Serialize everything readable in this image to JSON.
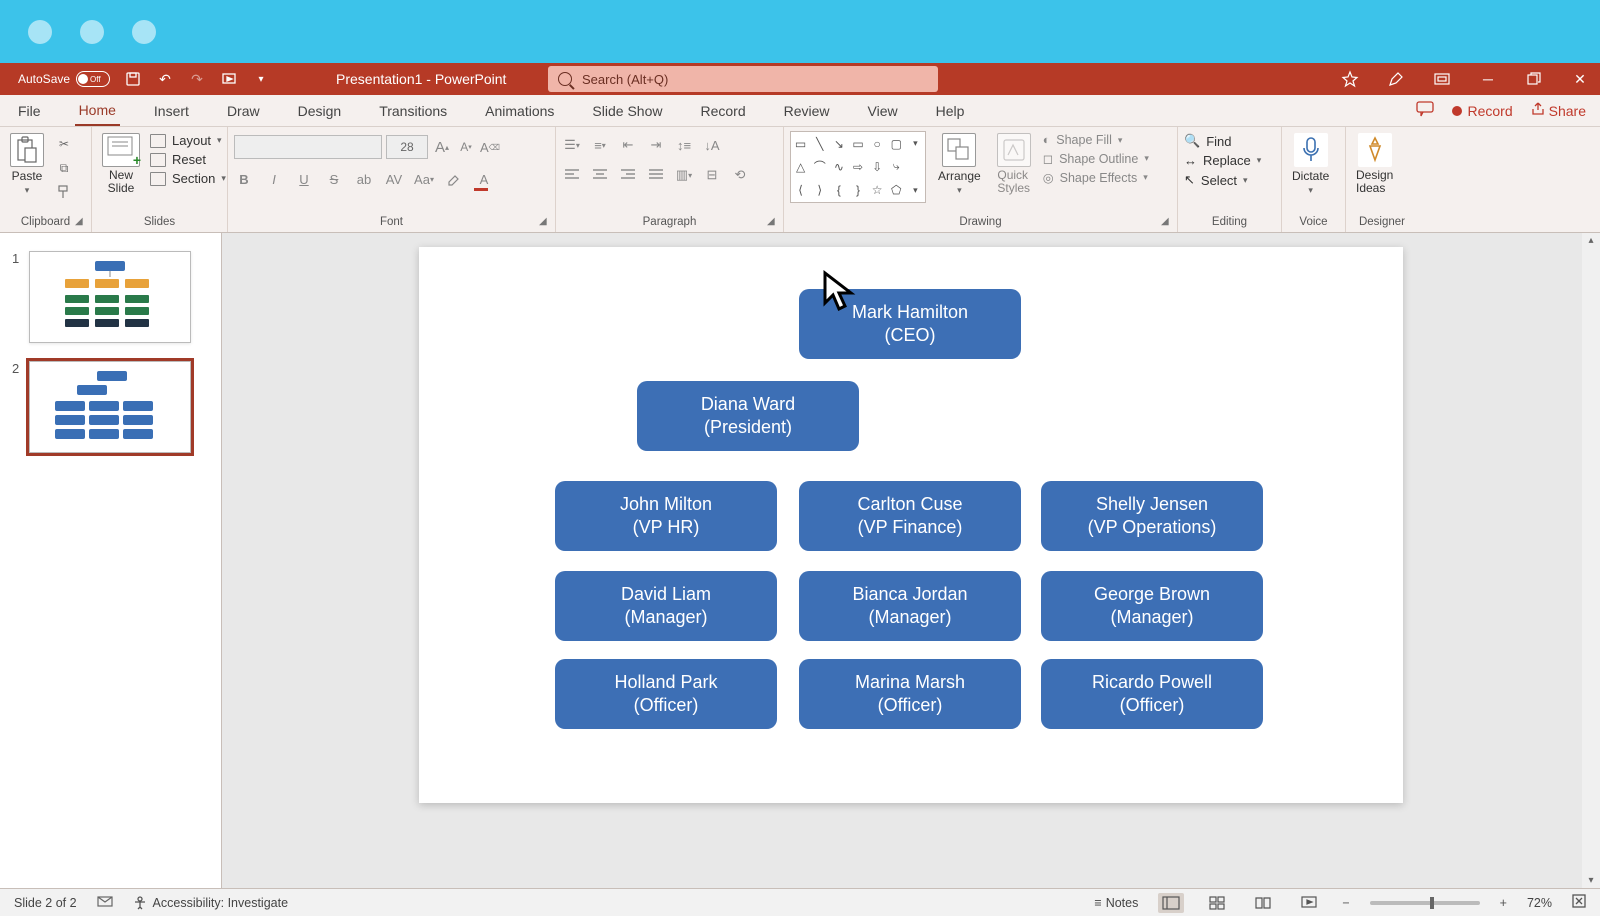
{
  "titlebar": {
    "autosave_label": "AutoSave",
    "autosave_state": "Off",
    "doc_title": "Presentation1 - PowerPoint",
    "search_placeholder": "Search (Alt+Q)"
  },
  "tabs": {
    "file": "File",
    "home": "Home",
    "insert": "Insert",
    "draw": "Draw",
    "design": "Design",
    "transitions": "Transitions",
    "animations": "Animations",
    "slideshow": "Slide Show",
    "record": "Record",
    "review": "Review",
    "view": "View",
    "help": "Help",
    "record_btn": "Record",
    "share_btn": "Share"
  },
  "ribbon": {
    "clipboard": {
      "paste": "Paste",
      "label": "Clipboard"
    },
    "slides": {
      "new_slide": "New\nSlide",
      "layout": "Layout",
      "reset": "Reset",
      "section": "Section",
      "label": "Slides"
    },
    "font": {
      "size_value": "28",
      "label": "Font"
    },
    "paragraph": {
      "label": "Paragraph"
    },
    "drawing": {
      "arrange": "Arrange",
      "quick_styles": "Quick\nStyles",
      "shape_fill": "Shape Fill",
      "shape_outline": "Shape Outline",
      "shape_effects": "Shape Effects",
      "label": "Drawing"
    },
    "editing": {
      "find": "Find",
      "replace": "Replace",
      "select": "Select",
      "label": "Editing"
    },
    "voice": {
      "dictate": "Dictate",
      "label": "Voice"
    },
    "designer": {
      "design_ideas": "Design\nIdeas",
      "label": "Designer"
    }
  },
  "thumbs": {
    "n1": "1",
    "n2": "2"
  },
  "org": {
    "ceo": {
      "name": "Mark Hamilton",
      "role": "(CEO)"
    },
    "president": {
      "name": "Diana Ward",
      "role": "(President)"
    },
    "vp1": {
      "name": "John Milton",
      "role": "(VP HR)"
    },
    "vp2": {
      "name": "Carlton Cuse",
      "role": "(VP Finance)"
    },
    "vp3": {
      "name": "Shelly Jensen",
      "role": "(VP Operations)"
    },
    "mgr1": {
      "name": "David Liam",
      "role": "(Manager)"
    },
    "mgr2": {
      "name": "Bianca Jordan",
      "role": "(Manager)"
    },
    "mgr3": {
      "name": "George Brown",
      "role": "(Manager)"
    },
    "off1": {
      "name": "Holland Park",
      "role": "(Officer)"
    },
    "off2": {
      "name": "Marina Marsh",
      "role": "(Officer)"
    },
    "off3": {
      "name": "Ricardo Powell",
      "role": "(Officer)"
    }
  },
  "status": {
    "slide_info": "Slide 2 of 2",
    "accessibility": "Accessibility: Investigate",
    "notes": "Notes",
    "zoom": "72%"
  },
  "chart_data": {
    "type": "org-chart",
    "title": "",
    "nodes": [
      {
        "id": "ceo",
        "name": "Mark Hamilton",
        "role": "CEO",
        "level": 0
      },
      {
        "id": "president",
        "name": "Diana Ward",
        "role": "President",
        "level": 1
      },
      {
        "id": "vp1",
        "name": "John Milton",
        "role": "VP HR",
        "level": 2
      },
      {
        "id": "vp2",
        "name": "Carlton Cuse",
        "role": "VP Finance",
        "level": 2
      },
      {
        "id": "vp3",
        "name": "Shelly Jensen",
        "role": "VP Operations",
        "level": 2
      },
      {
        "id": "mgr1",
        "name": "David Liam",
        "role": "Manager",
        "level": 3
      },
      {
        "id": "mgr2",
        "name": "Bianca Jordan",
        "role": "Manager",
        "level": 3
      },
      {
        "id": "mgr3",
        "name": "George Brown",
        "role": "Manager",
        "level": 3
      },
      {
        "id": "off1",
        "name": "Holland Park",
        "role": "Officer",
        "level": 4
      },
      {
        "id": "off2",
        "name": "Marina Marsh",
        "role": "Officer",
        "level": 4
      },
      {
        "id": "off3",
        "name": "Ricardo Powell",
        "role": "Officer",
        "level": 4
      }
    ]
  }
}
